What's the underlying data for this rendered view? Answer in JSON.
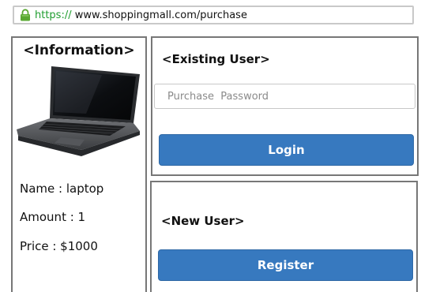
{
  "address_bar": {
    "scheme": "https://",
    "url": " www.shoppingmall.com/purchase",
    "lock_icon": "lock-icon",
    "lock_color": "#5aa832"
  },
  "info": {
    "title": "<Information>",
    "image": "laptop-image",
    "name": "Name : laptop",
    "amount": "Amount : 1",
    "price": "Price : $1000"
  },
  "existing_user": {
    "title": "<Existing User>",
    "password_placeholder": "Purchase  Password",
    "login_label": "Login"
  },
  "new_user": {
    "title": "<New User>",
    "register_label": "Register"
  },
  "colors": {
    "button": "#3779bf",
    "scheme": "#1f9d2f",
    "panel_border": "#777777"
  }
}
